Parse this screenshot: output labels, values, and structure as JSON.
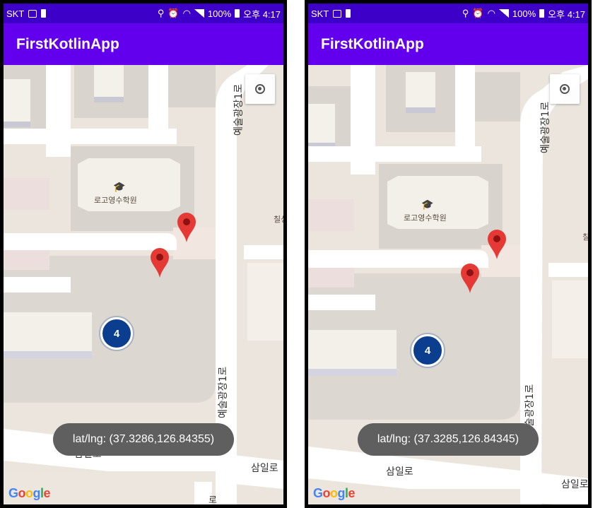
{
  "status_bar": {
    "carrier": "SKT",
    "battery_text": "100%",
    "time": "오후 4:17",
    "icons": [
      "image-icon",
      "battery-saver-icon",
      "location-icon",
      "alarm-icon",
      "hd-voice-icon",
      "wifi-icon",
      "signal-icon",
      "battery-icon"
    ]
  },
  "app": {
    "title": "FirstKotlinApp"
  },
  "map": {
    "poi_label": "로고영수학원",
    "poi_icon": "school-icon",
    "road_vertical": "예술광장1로",
    "road_horizontal_1": "삼일로",
    "road_horizontal_2": "삼일로",
    "edge_label": "칠성",
    "edge_label_bottom": "로",
    "cluster_count": "4",
    "attribution": [
      "G",
      "o",
      "o",
      "g",
      "l",
      "e"
    ],
    "colors": {
      "appbar": "#6200ee",
      "statusbar": "#3c00c8",
      "cluster": "#0b3e8f",
      "marker": "#e53935"
    }
  },
  "screens": [
    {
      "toast": "lat/lng: (37.3286,126.84355)"
    },
    {
      "toast": "lat/lng: (37.3285,126.84345)"
    }
  ]
}
